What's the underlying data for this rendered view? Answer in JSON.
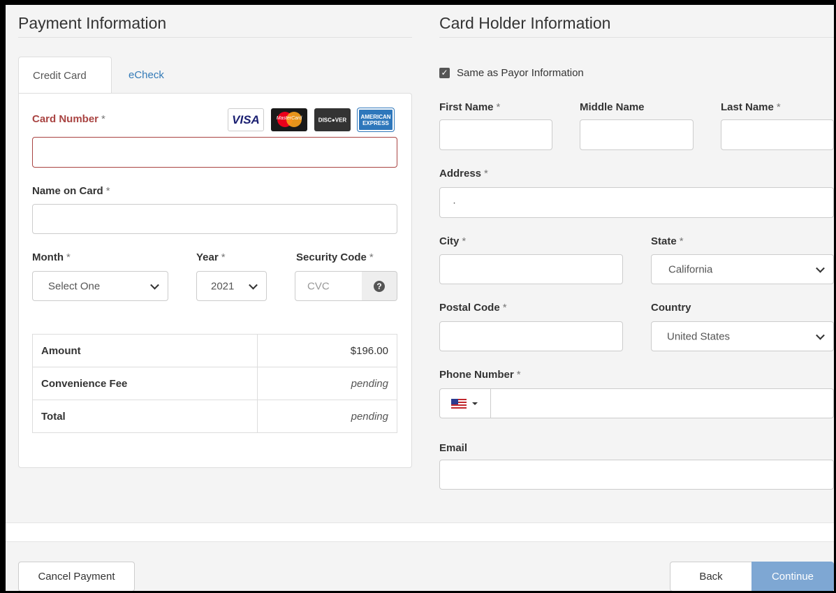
{
  "payment": {
    "title": "Payment Information",
    "tabs": [
      {
        "label": "Credit Card"
      },
      {
        "label": "eCheck"
      }
    ],
    "card_number_label": "Card Number",
    "card_brands": {
      "visa": "VISA",
      "mastercard": "MasterCard",
      "discover": "DISC●VER",
      "amex": "AMERICAN EXPRESS"
    },
    "name_on_card_label": "Name on Card",
    "month_label": "Month",
    "month_value": "Select One",
    "year_label": "Year",
    "year_value": "2021",
    "security_label": "Security Code",
    "security_placeholder": "CVC",
    "required_mark": "*",
    "summary": [
      {
        "label": "Amount",
        "value": "$196.00"
      },
      {
        "label": "Convenience Fee",
        "value": "pending"
      },
      {
        "label": "Total",
        "value": "pending"
      }
    ]
  },
  "holder": {
    "title": "Card Holder Information",
    "same_as_payor": "Same as Payor Information",
    "first_name_label": "First Name",
    "middle_name_label": "Middle Name",
    "last_name_label": "Last Name",
    "address_label": "Address",
    "address_value": "·",
    "city_label": "City",
    "state_label": "State",
    "state_value": "California",
    "postal_label": "Postal Code",
    "country_label": "Country",
    "country_value": "United States",
    "phone_label": "Phone Number",
    "email_label": "Email"
  },
  "footer": {
    "cancel": "Cancel Payment",
    "back": "Back",
    "continue": "Continue"
  },
  "colors": {
    "accent": "#337ab7",
    "error": "#a94442",
    "continue_bg": "#7ea7d3"
  }
}
